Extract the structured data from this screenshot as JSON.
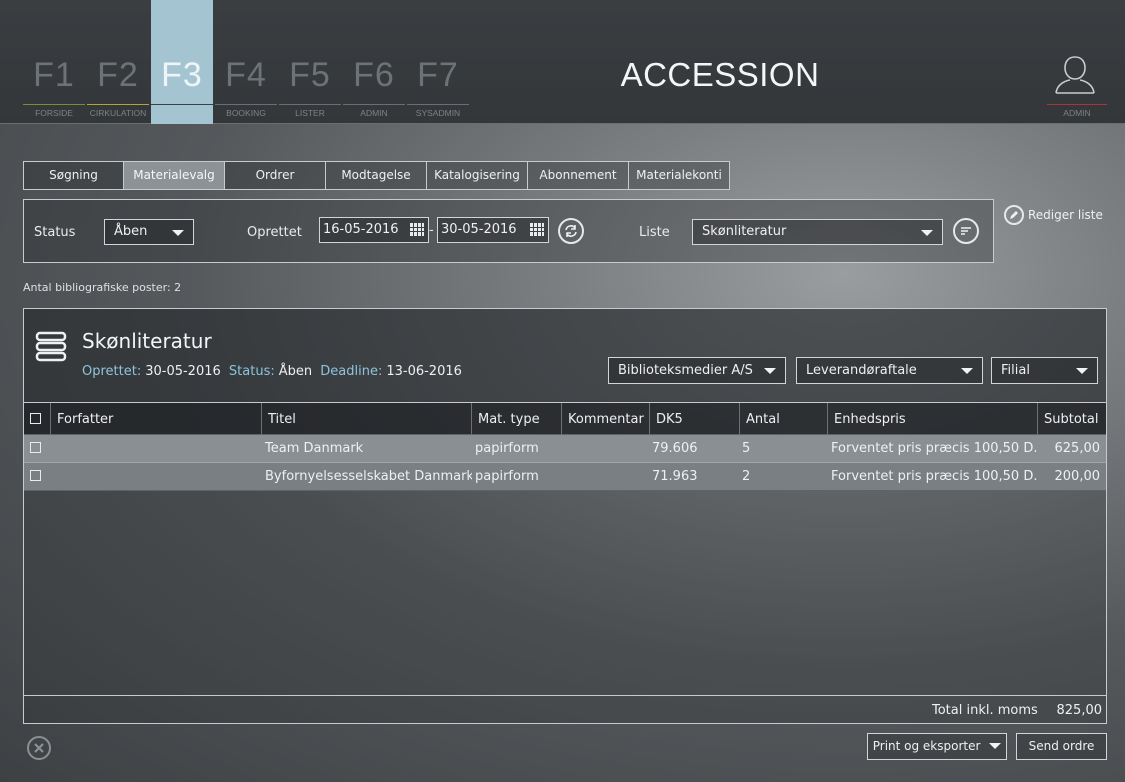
{
  "header": {
    "title": "ACCESSION",
    "fkeys": [
      {
        "key": "F1",
        "label": "FORSIDE"
      },
      {
        "key": "F2",
        "label": "CIRKULATION"
      },
      {
        "key": "F3",
        "label": ""
      },
      {
        "key": "F4",
        "label": "BOOKING"
      },
      {
        "key": "F5",
        "label": "LISTER"
      },
      {
        "key": "F6",
        "label": "ADMIN"
      },
      {
        "key": "F7",
        "label": "SYSADMIN"
      }
    ],
    "user_label": "ADMIN",
    "colors": {
      "active_tab": "#a5c4d2",
      "accent_link": "#8ec3dc",
      "user_line": "#a33a3a"
    }
  },
  "tabs": [
    "Søgning",
    "Materialevalg",
    "Ordrer",
    "Modtagelse",
    "Katalogisering",
    "Abonnement",
    "Materialekonti"
  ],
  "filter": {
    "status_label": "Status",
    "status_value": "Åben",
    "oprettet_label": "Oprettet",
    "date_from": "16-05-2016",
    "date_sep": "-",
    "date_to": "30-05-2016",
    "liste_label": "Liste",
    "liste_value": "Skønliteratur",
    "rediger_label": "Rediger liste"
  },
  "count_label": "Antal bibliografiske poster: 2",
  "order": {
    "title": "Skønliteratur",
    "oprettet_key": "Oprettet:",
    "oprettet_val": "30-05-2016",
    "status_key": "Status:",
    "status_val": "Åben",
    "deadline_key": "Deadline:",
    "deadline_val": "13-06-2016",
    "supplier": "Biblioteksmedier A/S",
    "agreement": "Leverandøraftale",
    "branch": "Filial",
    "columns": [
      "Forfatter",
      "Titel",
      "Mat. type",
      "Kommentar",
      "DK5",
      "Antal",
      "Enhedspris",
      "Subtotal"
    ],
    "rows": [
      {
        "forfatter": "",
        "titel": "Team Danmark",
        "mat_type": "papirform",
        "kommentar": "",
        "dk5": "79.606",
        "antal": "5",
        "enhedspris": "Forventet pris præcis 100,50 D...",
        "subtotal": "625,00"
      },
      {
        "forfatter": "",
        "titel": "Byfornyelsesselskabet Danmark",
        "mat_type": "papirform",
        "kommentar": "",
        "dk5": "71.963",
        "antal": "2",
        "enhedspris": "Forventet pris præcis 100,50 D...",
        "subtotal": "200,00"
      }
    ],
    "total_label": "Total inkl. moms",
    "total_value": "825,00"
  },
  "actions": {
    "print_label": "Print og eksporter",
    "send_label": "Send ordre"
  }
}
